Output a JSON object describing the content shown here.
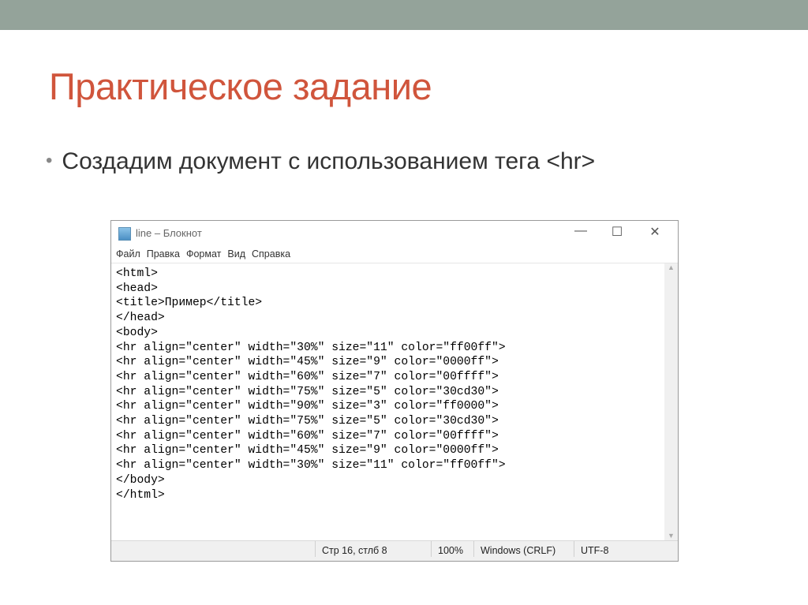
{
  "slide": {
    "title": "Практическое задание",
    "bullet": "Создадим документ с использованием тега <hr>"
  },
  "notepad": {
    "title": "line – Блокнот",
    "controls": {
      "minimize": "—",
      "maximize": "☐",
      "close": "✕"
    },
    "menu": [
      "Файл",
      "Правка",
      "Формат",
      "Вид",
      "Справка"
    ],
    "lines": [
      "<html>",
      "<head>",
      "<title>Пример</title>",
      "</head>",
      "<body>",
      "<hr align=\"center\" width=\"30%\" size=\"11\" color=\"ff00ff\">",
      "<hr align=\"center\" width=\"45%\" size=\"9\" color=\"0000ff\">",
      "<hr align=\"center\" width=\"60%\" size=\"7\" color=\"00ffff\">",
      "<hr align=\"center\" width=\"75%\" size=\"5\" color=\"30cd30\">",
      "<hr align=\"center\" width=\"90%\" size=\"3\" color=\"ff0000\">",
      "<hr align=\"center\" width=\"75%\" size=\"5\" color=\"30cd30\">",
      "<hr align=\"center\" width=\"60%\" size=\"7\" color=\"00ffff\">",
      "<hr align=\"center\" width=\"45%\" size=\"9\" color=\"0000ff\">",
      "<hr align=\"center\" width=\"30%\" size=\"11\" color=\"ff00ff\">",
      "</body>",
      "</html>"
    ],
    "status": {
      "position": "Стр 16, стлб 8",
      "zoom": "100%",
      "eol": "Windows (CRLF)",
      "encoding": "UTF-8"
    }
  }
}
